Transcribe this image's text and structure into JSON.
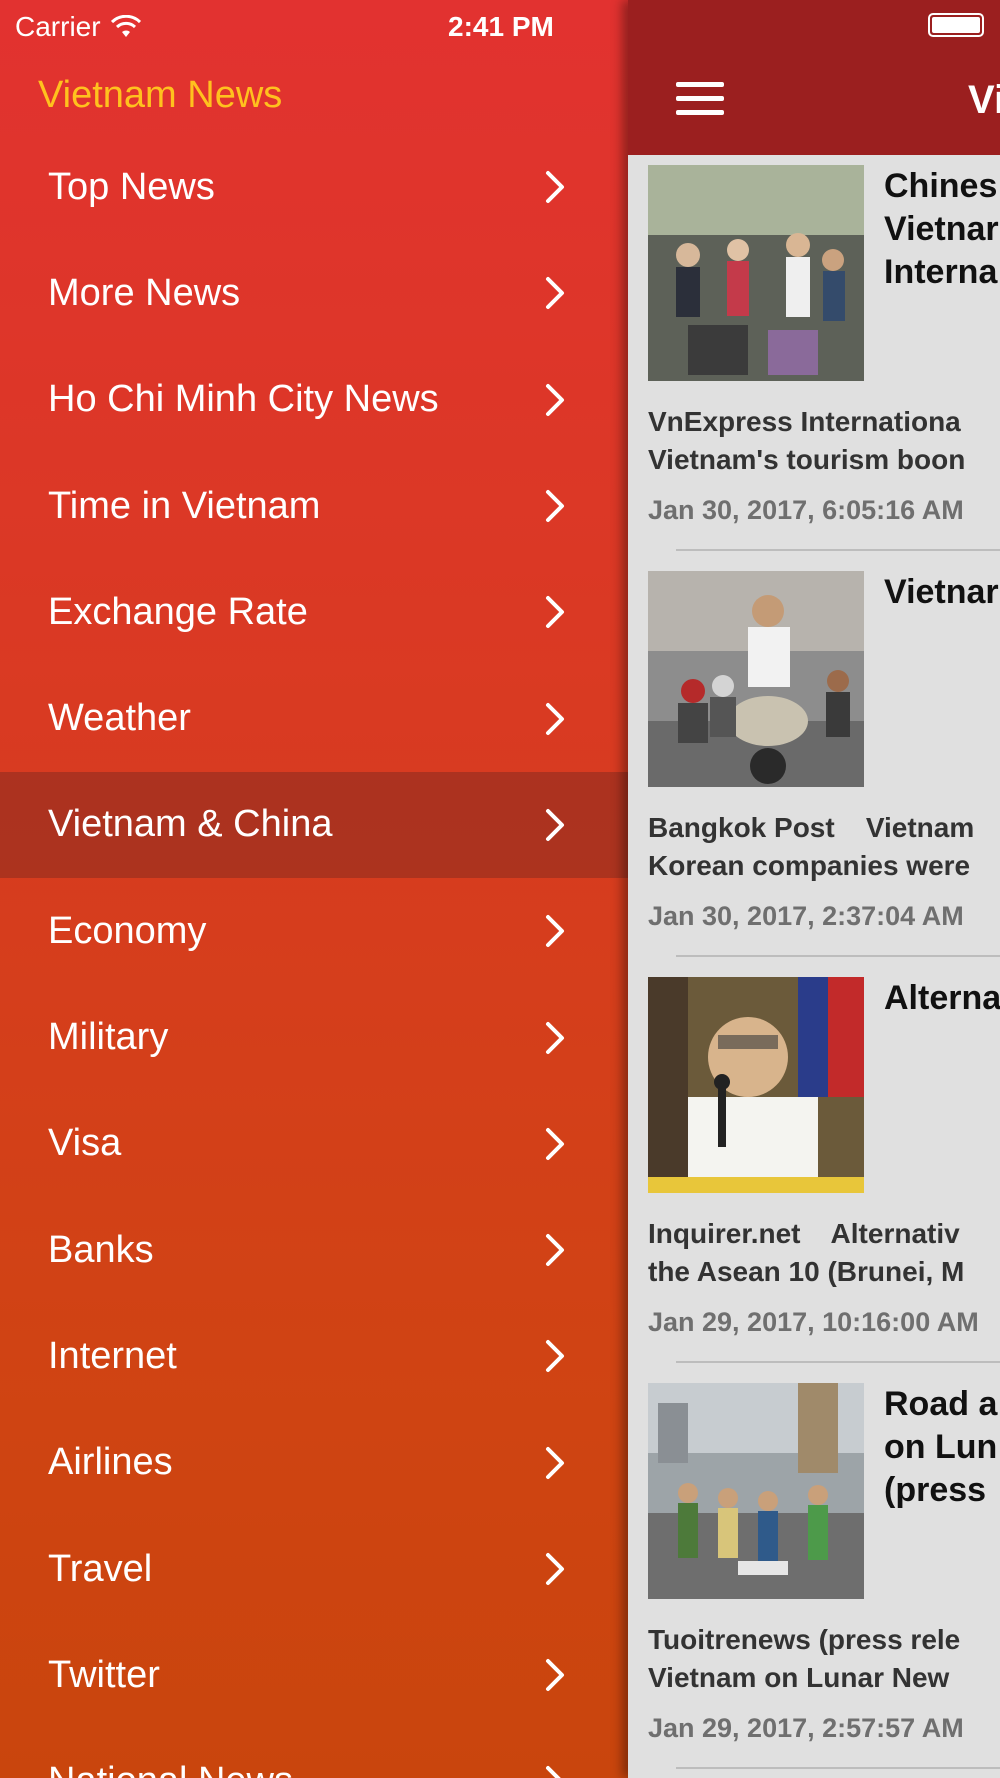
{
  "status_bar": {
    "carrier": "Carrier",
    "time": "2:41 PM"
  },
  "drawer": {
    "title": "Vietnam News",
    "items": [
      {
        "label": "Top News"
      },
      {
        "label": "More News"
      },
      {
        "label": "Ho Chi Minh City News"
      },
      {
        "label": "Time in Vietnam"
      },
      {
        "label": "Exchange Rate"
      },
      {
        "label": "Weather"
      },
      {
        "label": "Vietnam & China",
        "selected": true
      },
      {
        "label": "Economy"
      },
      {
        "label": "Military"
      },
      {
        "label": "Visa"
      },
      {
        "label": "Banks"
      },
      {
        "label": "Internet"
      },
      {
        "label": "Airlines"
      },
      {
        "label": "Travel"
      },
      {
        "label": "Twitter"
      },
      {
        "label": "National News"
      }
    ]
  },
  "main": {
    "nav_title": "Vi",
    "articles": [
      {
        "headline": "Chines\nVietnar\nInterna",
        "snippet": "VnExpress Internationa\nVietnam's tourism boon",
        "date": "Jan 30, 2017, 6:05:16 AM"
      },
      {
        "headline": "Vietnar",
        "snippet": "Bangkok Post    Vietnam\nKorean companies were",
        "date": "Jan 30, 2017, 2:37:04 AM"
      },
      {
        "headline": "Alterna",
        "snippet": "Inquirer.net    Alternativ\nthe Asean 10 (Brunei, M",
        "date": "Jan 29, 2017, 10:16:00 AM"
      },
      {
        "headline": "Road a\non Lun\n(press",
        "snippet": "Tuoitrenews (press rele\nVietnam on Lunar New",
        "date": "Jan 29, 2017, 2:57:57 AM"
      }
    ]
  },
  "colors": {
    "drawer_top": "#e23230",
    "drawer_bottom": "#c9450d",
    "title_yellow": "#ffc11e",
    "navbar": "#9b1f1f",
    "feed_bg": "#e0e0e0"
  },
  "icons": [
    "wifi-icon",
    "chevron-right-icon",
    "hamburger-menu-icon",
    "battery-icon"
  ]
}
